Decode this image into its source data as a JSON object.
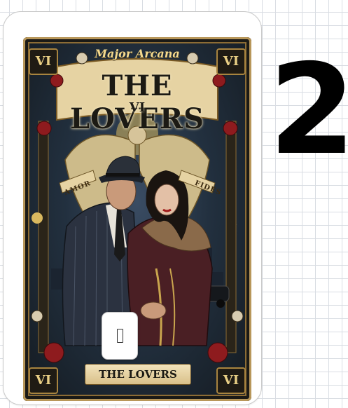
{
  "card": {
    "arcana_label": "Major Arcana",
    "title": "THE LOVERS",
    "numeral": "VI",
    "corner_numeral": "VI",
    "ribbon_left": "AMOR",
    "ribbon_right": "FIDES",
    "banner_label": "THE LOVERS"
  },
  "counter": {
    "value": "2"
  },
  "icons": {
    "placeholder": "empty-box-glyph-icon"
  },
  "colors": {
    "gold": "#b8975a",
    "background": "#ffffff",
    "counter_text": "#000000"
  }
}
